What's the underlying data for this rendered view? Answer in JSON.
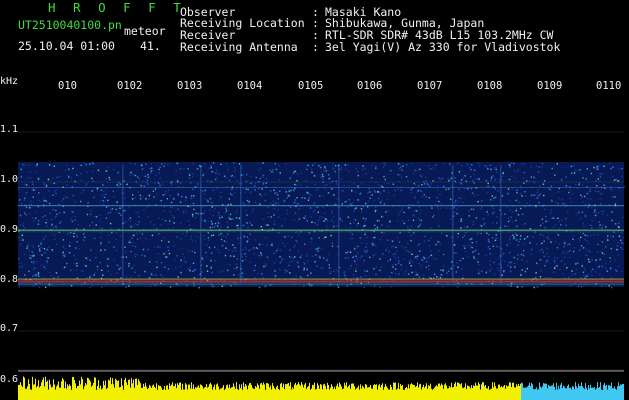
{
  "header": {
    "app_title": "H R O F F T",
    "filename": "UT2510040100.pn",
    "meteor_label": "meteor",
    "datetime": "25.10.04 01:00",
    "count": "41.",
    "info": [
      {
        "key": "Observer",
        "value": "Masaki Kano"
      },
      {
        "key": "Receiving Location",
        "value": "Shibukawa, Gunma, Japan"
      },
      {
        "key": "Receiver",
        "value": "RTL-SDR SDR# 43dB L15 103.2MHz CW"
      },
      {
        "key": "Receiving Antenna",
        "value": "3el Yagi(V) Az 330 for Vladivostok"
      }
    ],
    "colon": ":"
  },
  "axis": {
    "unit": "kHz",
    "y_ticks": [
      "1.1",
      "1.0",
      "0.9",
      "0.8",
      "0.7",
      "0.6"
    ],
    "x_ticks": [
      "010",
      "0102",
      "0103",
      "0104",
      "0105",
      "0106",
      "0107",
      "0108",
      "0109",
      "0110"
    ]
  },
  "colors": {
    "text": "#f0f0f0",
    "title": "#3fdc3f",
    "background": "#000000",
    "noise": "#1a3aa0",
    "signal": "#e03020",
    "bar_yellow": "#f0f000",
    "bar_cyan": "#40c8f0"
  }
}
